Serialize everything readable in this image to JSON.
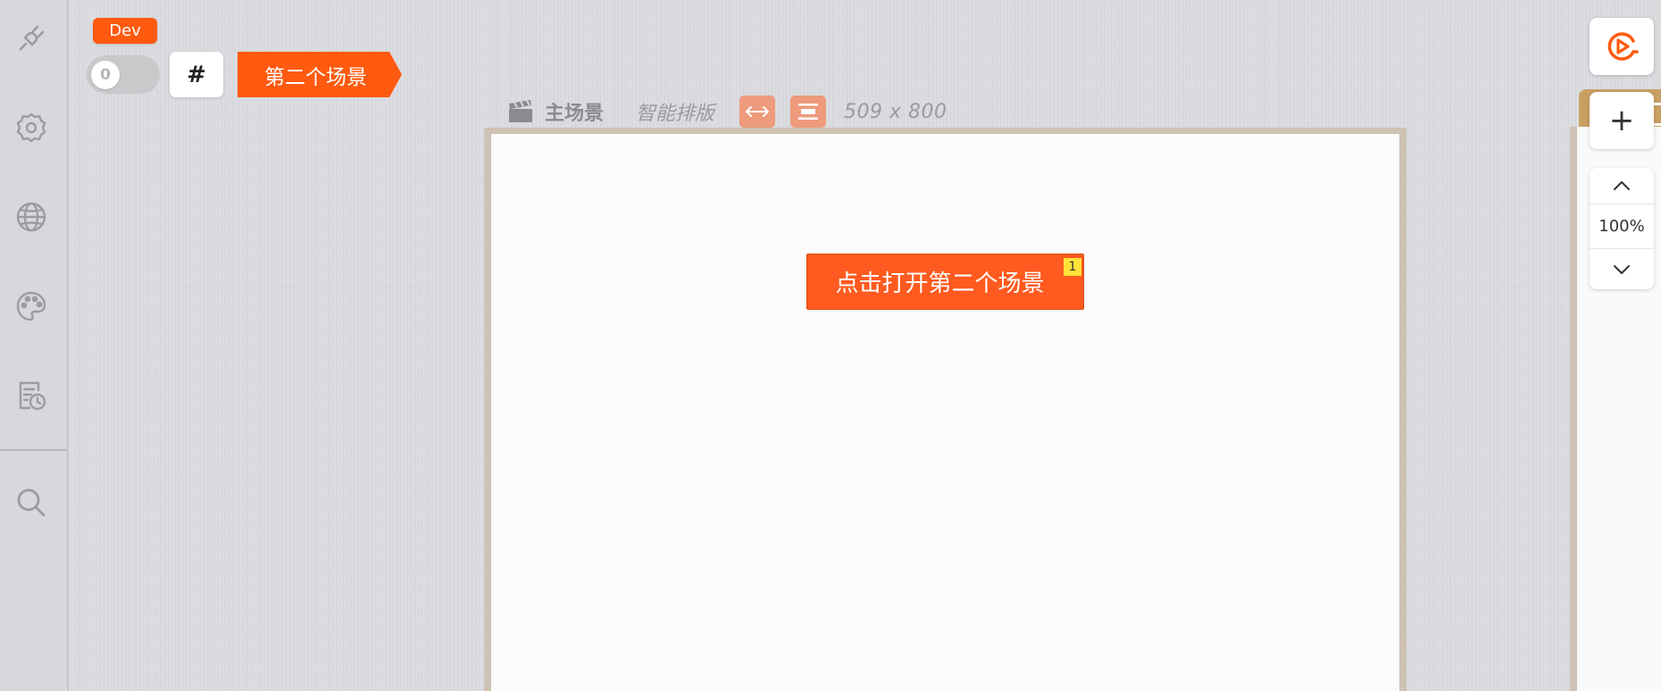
{
  "sidebar": {
    "items": [
      {
        "name": "plugin-icon"
      },
      {
        "name": "settings-icon"
      },
      {
        "name": "globe-icon"
      },
      {
        "name": "palette-icon"
      },
      {
        "name": "history-icon"
      },
      {
        "name": "search-icon"
      }
    ]
  },
  "header": {
    "env_badge": "Dev",
    "toggle_value": "0",
    "hash_label": "#",
    "scene_tab_label": "第二个场景"
  },
  "canvas_toolbar": {
    "scene_label": "主场景",
    "smart_layout_label": "智能排版",
    "size_label": "509 x 800"
  },
  "canvas": {
    "primary_button_label": "点击打开第二个场景",
    "primary_button_badge": "1"
  },
  "right_controls": {
    "add_label": "+",
    "zoom_value": "100%"
  },
  "colors": {
    "accent": "#ff5a0f",
    "badge": "#ffe23a",
    "tool_button": "#ee9a7c",
    "frame": "#cfc1b3"
  }
}
